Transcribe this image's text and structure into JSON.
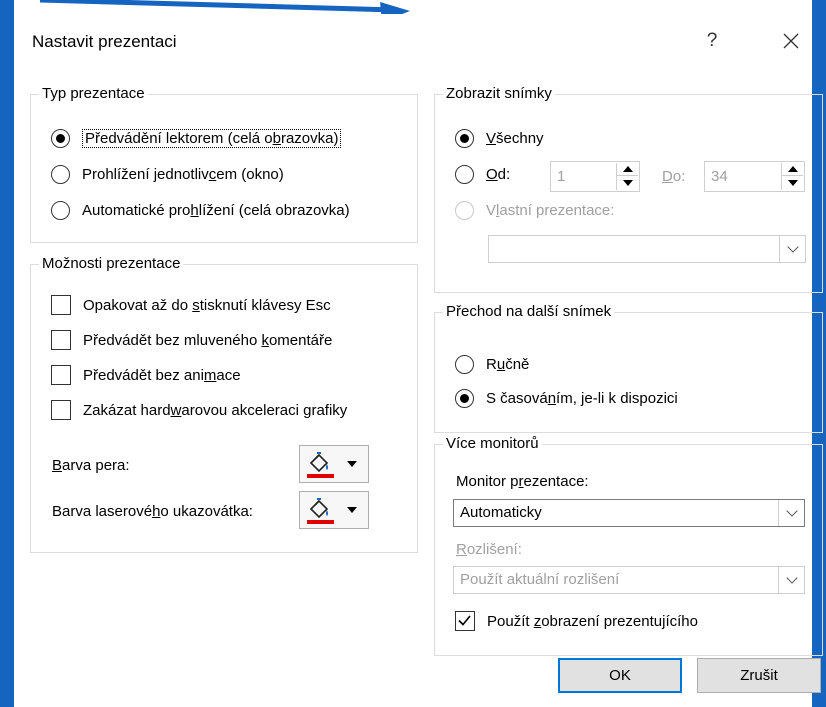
{
  "dialog": {
    "title": "Nastavit prezentaci",
    "help_label": "?"
  },
  "show_type": {
    "title": "Typ prezentace",
    "options": [
      {
        "pre": "Předvádění lektorem (celá o",
        "key": "b",
        "post": "razovka)",
        "checked": true
      },
      {
        "pre": "Prohlížení jednotliv",
        "key": "c",
        "post": "em (okno)",
        "checked": false
      },
      {
        "pre": "Automatické pro",
        "key": "h",
        "post": "lížení (celá obrazovka)",
        "checked": false
      }
    ]
  },
  "show_options": {
    "title": "Možnosti prezentace",
    "checkboxes": [
      {
        "pre": "Opakovat až do ",
        "key": "s",
        "post": "tisknutí klávesy Esc",
        "checked": false
      },
      {
        "pre": "Předvádět bez mluveného ",
        "key": "k",
        "post": "omentáře",
        "checked": false
      },
      {
        "pre": "Předvádět bez ani",
        "key": "m",
        "post": "ace",
        "checked": false
      },
      {
        "pre": "Zakázat hard",
        "key": "w",
        "post": "arovou akceleraci grafiky",
        "checked": false
      }
    ],
    "pen_color": {
      "pre": "",
      "key": "B",
      "post": "arva pera:",
      "color": "#e00000"
    },
    "laser_color": {
      "pre": "Barva laserové",
      "key": "h",
      "post": "o ukazovátka:",
      "color": "#e00000"
    }
  },
  "show_slides": {
    "title": "Zobrazit snímky",
    "all": {
      "pre": "",
      "key": "V",
      "post": "šechny",
      "checked": true
    },
    "from": {
      "pre": "",
      "key": "O",
      "post": "d:",
      "value": "1"
    },
    "to": {
      "pre": "",
      "key": "D",
      "post": "o:",
      "value": "34"
    },
    "custom": {
      "pre": "V",
      "key": "l",
      "post": "astní prezentace:"
    },
    "custom_value": ""
  },
  "advance": {
    "title": "Přechod na další snímek",
    "manual": {
      "pre": "R",
      "key": "u",
      "post": "čně",
      "checked": false
    },
    "timings": {
      "pre": "S časová",
      "key": "n",
      "post": "ím, je-li k dispozici",
      "checked": true
    }
  },
  "monitors": {
    "title": "Více monitorů",
    "monitor_label": {
      "pre": "Monitor p",
      "key": "r",
      "post": "ezentace:"
    },
    "monitor_value": "Automaticky",
    "resolution_label": {
      "pre": "",
      "key": "R",
      "post": "ozlišení:"
    },
    "resolution_value": "Použít aktuální rozlišení",
    "presenter_view": {
      "pre": "Použít ",
      "key": "z",
      "post": "obrazení prezentujícího",
      "checked": true
    }
  },
  "buttons": {
    "ok": "OK",
    "cancel": "Zrušit"
  },
  "colors": {
    "frame": "#1565c0",
    "focus": "#0078d7",
    "pen": "#e00000"
  }
}
